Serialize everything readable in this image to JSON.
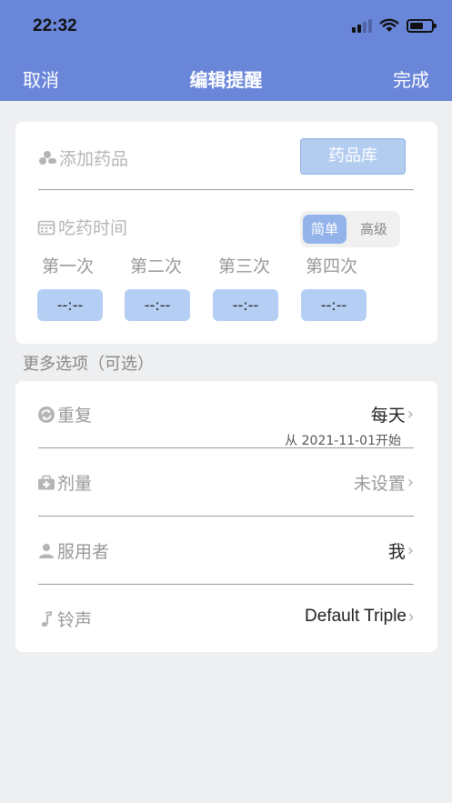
{
  "status_bar": {
    "time": "22:32"
  },
  "nav": {
    "cancel": "取消",
    "title": "编辑提醒",
    "done": "完成"
  },
  "medicine": {
    "placeholder": "添加药品",
    "library_button": "药品库"
  },
  "schedule": {
    "label": "吃药时间",
    "mode_simple": "简单",
    "mode_advanced": "高级",
    "selected_mode": "简单",
    "doses": [
      {
        "label": "第一次",
        "time": "--:--"
      },
      {
        "label": "第二次",
        "time": "--:--"
      },
      {
        "label": "第三次",
        "time": "--:--"
      },
      {
        "label": "第四次",
        "time": "--:--"
      }
    ]
  },
  "more_options_label": "更多选项（可选）",
  "options": {
    "repeat": {
      "label": "重复",
      "value": "每天",
      "note": "从 2021-11-01开始"
    },
    "dosage": {
      "label": "剂量",
      "value": "未设置"
    },
    "taker": {
      "label": "服用者",
      "value": "我"
    },
    "ringtone": {
      "label": "铃声",
      "value": "Default Triple"
    }
  },
  "colors": {
    "header": "#6a86d9",
    "accent_light": "#b3cdf1",
    "segment_selected": "#93b4ea",
    "background": "#eeeff1"
  },
  "icons": {
    "medicine": "pills-icon",
    "calendar": "calendar-icon",
    "repeat": "repeat-icon",
    "dosage": "medkit-icon",
    "taker": "person-icon",
    "ringtone": "music-note-icon",
    "chevron": "chevron-right-icon"
  }
}
